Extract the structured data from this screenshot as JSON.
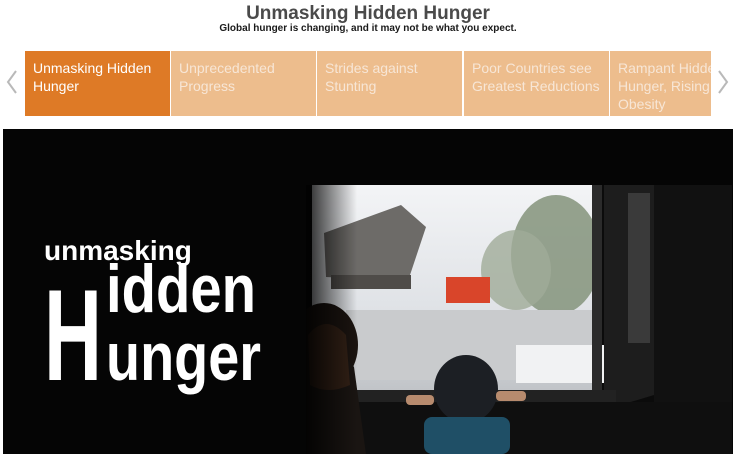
{
  "header": {
    "title": "Unmasking Hidden Hunger",
    "subtitle": "Global hunger is changing, and it may not be what you expect."
  },
  "tabs": [
    {
      "label": "Unmasking Hidden Hunger",
      "active": true
    },
    {
      "label": "Unprecedented Progress",
      "active": false
    },
    {
      "label": "Strides against Stunting",
      "active": false
    },
    {
      "label": "Poor Countries see Greatest Reductions",
      "active": false
    },
    {
      "label": "Rampant Hidden Hunger, Rising Obesity",
      "active": false
    }
  ],
  "hero": {
    "logo_line1": "unmasking",
    "logo_line2": "idden",
    "logo_line3": "unger",
    "logo_initial": "H"
  },
  "colors": {
    "tab_active": "#de7a26",
    "tab_inactive": "#edbd8d",
    "hero_bg": "#050505"
  },
  "icons": {
    "prev": "chevron-left-icon",
    "next": "chevron-right-icon"
  }
}
